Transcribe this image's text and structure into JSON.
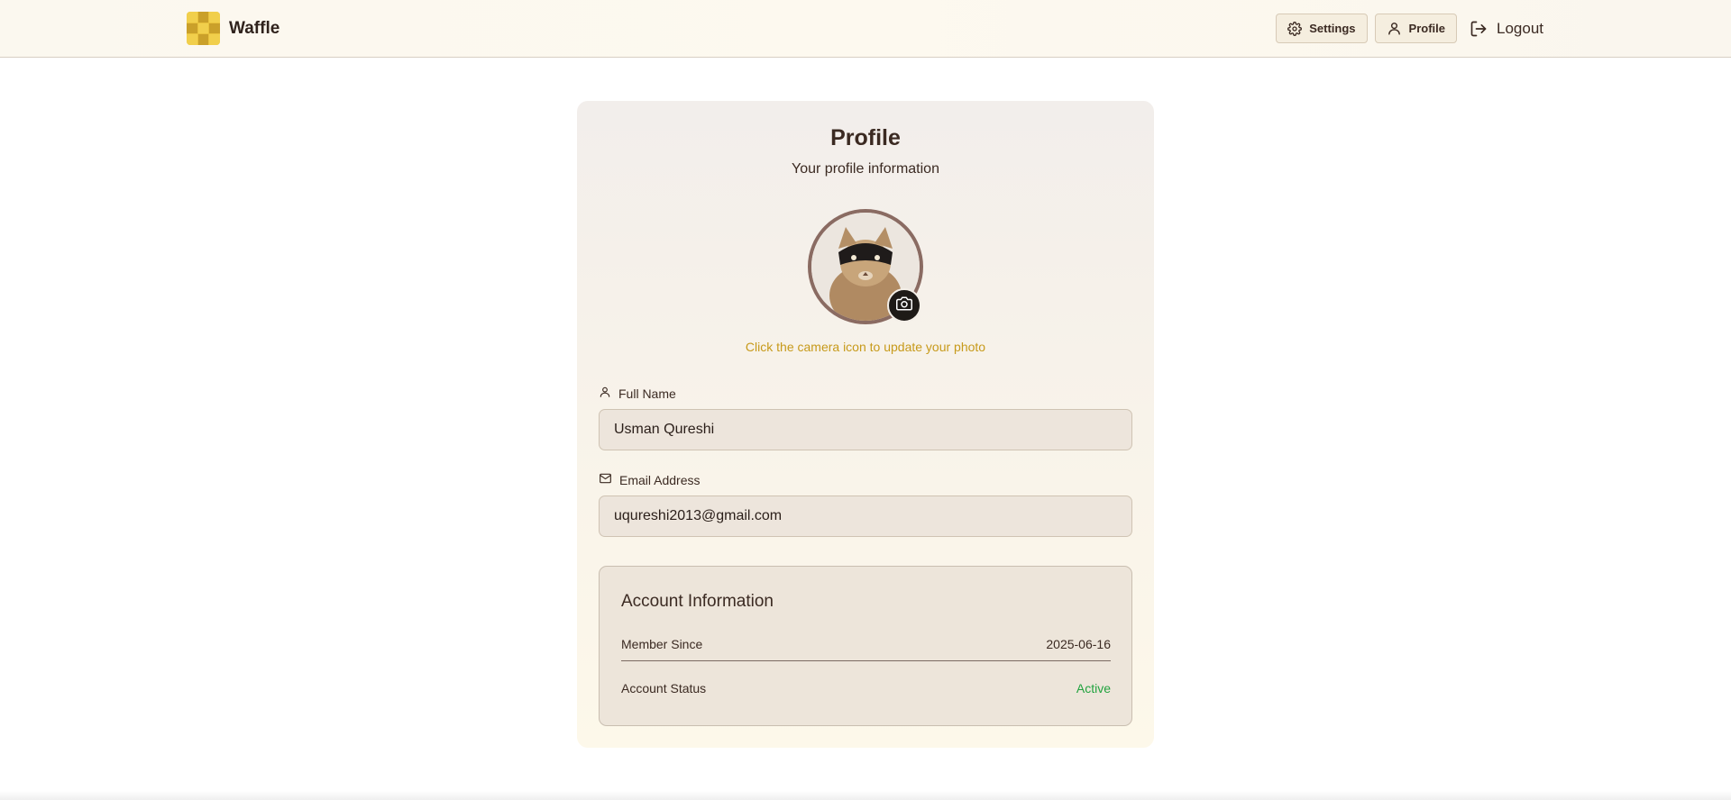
{
  "header": {
    "brand": "Waffle",
    "nav": {
      "settings_label": "Settings",
      "profile_label": "Profile",
      "logout_label": "Logout"
    }
  },
  "profile": {
    "title": "Profile",
    "subtitle": "Your profile information",
    "avatar_icon": "user-photo",
    "camera_icon": "camera-icon",
    "photo_hint": "Click the camera icon to update your photo",
    "full_name": {
      "label": "Full Name",
      "value": "Usman Qureshi",
      "icon": "user-icon"
    },
    "email": {
      "label": "Email Address",
      "value": "uqureshi2013@gmail.com",
      "icon": "mail-icon"
    },
    "account": {
      "title": "Account Information",
      "member_since_label": "Member Since",
      "member_since_value": "2025-06-16",
      "status_label": "Account Status",
      "status_value": "Active"
    }
  },
  "colors": {
    "accent_gold": "#c79a1a",
    "status_active": "#22a33f",
    "text_brown": "#3b2a22"
  }
}
